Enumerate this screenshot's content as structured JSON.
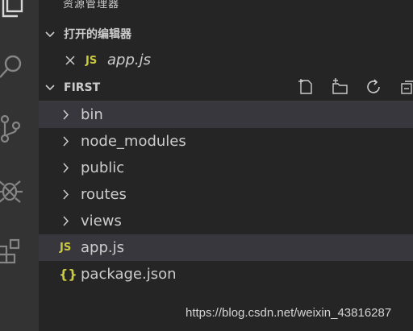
{
  "explorer": {
    "top_title": "资源管理器",
    "open_editors": {
      "header": "打开的编辑器",
      "files": [
        {
          "badge": "JS",
          "name": "app.js"
        }
      ]
    },
    "folder": {
      "header": "FIRST",
      "items": [
        {
          "label": "bin",
          "type": "folder"
        },
        {
          "label": "node_modules",
          "type": "folder"
        },
        {
          "label": "public",
          "type": "folder"
        },
        {
          "label": "routes",
          "type": "folder"
        },
        {
          "label": "views",
          "type": "folder"
        },
        {
          "label": "app.js",
          "type": "file",
          "badge": "JS"
        },
        {
          "label": "package.json",
          "type": "file",
          "badge": "{}"
        }
      ]
    },
    "toolbar_icons": [
      "new-file-icon",
      "new-folder-icon",
      "refresh-icon",
      "collapse-all-icon"
    ]
  },
  "activity_icons": [
    "explorer-icon",
    "search-icon",
    "source-control-icon",
    "debug-icon",
    "extensions-icon"
  ],
  "watermark": "https://blog.csdn.net/weixin_43816287",
  "colors": {
    "activity_bg": "#333333",
    "sidebar_bg": "#252526",
    "selected_row": "#37373d",
    "js_badge": "#cbcb41",
    "text": "#cccccc"
  }
}
